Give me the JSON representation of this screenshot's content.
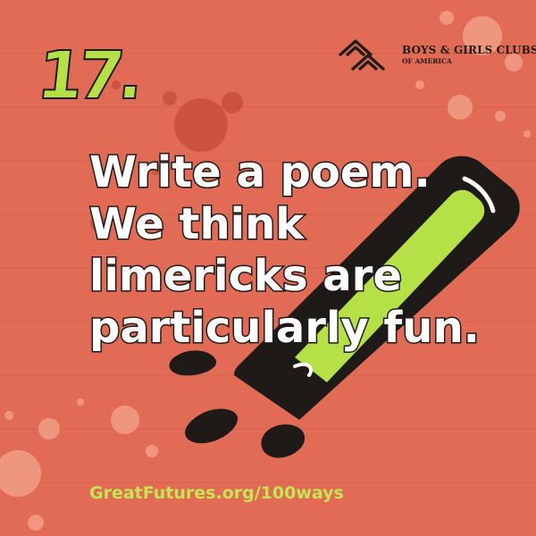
{
  "card": {
    "number": "17.",
    "headline_lines": [
      "Write a poem.",
      "We think",
      "limericks are",
      "particularly fun."
    ],
    "url": "GreatFutures.org/100ways"
  },
  "logo": {
    "line1": "BOYS & GIRLS CLUBS",
    "line2": "OF AMERICA"
  },
  "icons": {
    "marker": "marker-pen-icon",
    "logo": "bgca-hands-logo-icon"
  },
  "colors": {
    "background": "#e16b55",
    "accent_green": "#b5e147",
    "text_white": "#ffffff",
    "outline": "#1e1a18"
  }
}
